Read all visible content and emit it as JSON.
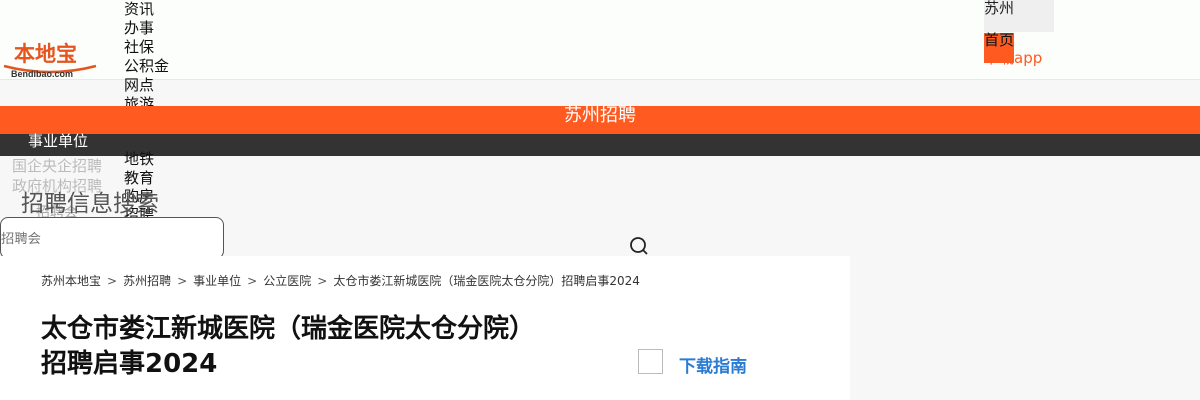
{
  "logo": {
    "text": "本地宝",
    "sub": "Bendibao.com"
  },
  "nav": {
    "items": [
      "资讯",
      "办事",
      "社保",
      "公积金",
      "网点",
      "旅游"
    ],
    "overflow_items": [
      "地铁",
      "教育",
      "购房",
      "招聘"
    ]
  },
  "city": {
    "name": "苏州"
  },
  "header_links": {
    "home": "首页",
    "app": "下载app"
  },
  "channel": {
    "title": "苏州招聘"
  },
  "category": {
    "current": "事业单位",
    "sub": [
      "国企央企招聘",
      "政府机构招聘"
    ]
  },
  "search": {
    "title": "招聘信息搜索",
    "placeholder": "招聘会"
  },
  "breadcrumb": {
    "items": [
      "苏州本地宝",
      "苏州招聘",
      "事业单位",
      "公立医院",
      "太仓市娄江新城医院（瑞金医院太仓分院）招聘启事2024"
    ],
    "separator": ">"
  },
  "article": {
    "title_line1": "太仓市娄江新城医院（瑞金医院太仓分院）",
    "title_line2": "招聘启事2024",
    "guide_label": "下载指南"
  },
  "colors": {
    "accent": "#ff5a1f",
    "dark_bar": "#333333",
    "link": "#2a7bd3"
  }
}
